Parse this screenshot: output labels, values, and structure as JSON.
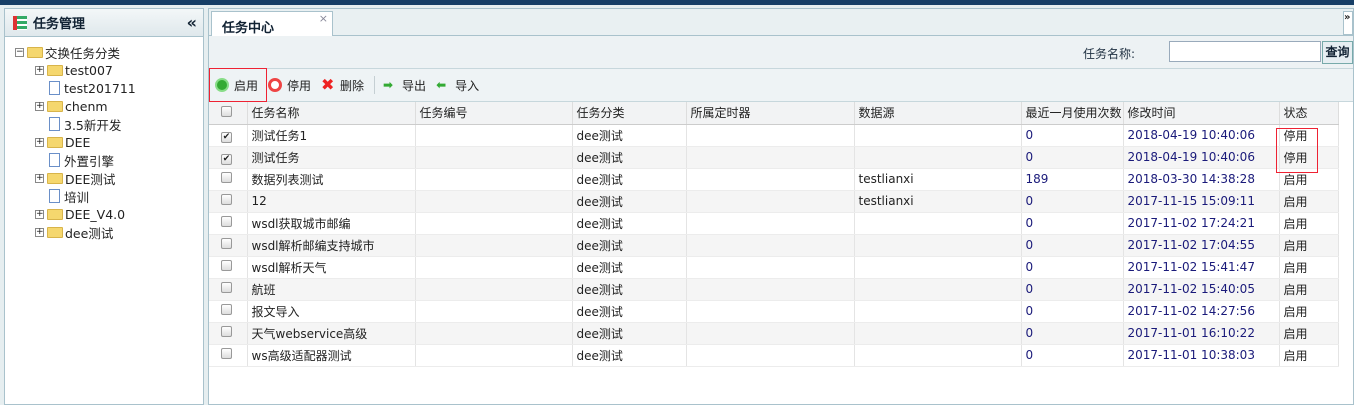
{
  "left": {
    "title": "任务管理",
    "collapse": "«",
    "tree": [
      {
        "label": "交换任务分类",
        "type": "folder",
        "level": 0,
        "expander": "−"
      },
      {
        "label": "test007",
        "type": "folder",
        "level": 1,
        "expander": "+"
      },
      {
        "label": "test201711",
        "type": "file",
        "level": 1
      },
      {
        "label": "chenm",
        "type": "folder",
        "level": 1,
        "expander": "+"
      },
      {
        "label": "3.5新开发",
        "type": "file",
        "level": 1
      },
      {
        "label": "DEE",
        "type": "folder",
        "level": 1,
        "expander": "+"
      },
      {
        "label": "外置引擎",
        "type": "file",
        "level": 1
      },
      {
        "label": "DEE测试",
        "type": "folder",
        "level": 1,
        "expander": "+"
      },
      {
        "label": "培训",
        "type": "file",
        "level": 1
      },
      {
        "label": "DEE_V4.0",
        "type": "folder",
        "level": 1,
        "expander": "+"
      },
      {
        "label": "dee测试",
        "type": "folder",
        "level": 1,
        "expander": "+"
      }
    ]
  },
  "tab": {
    "label": "任务中心",
    "close": "×",
    "scroll": "»"
  },
  "search": {
    "label": "任务名称:",
    "value": "",
    "button": "查询"
  },
  "toolbar": {
    "enable": "启用",
    "disable": "停用",
    "delete": "删除",
    "export": "导出",
    "import": "导入"
  },
  "table": {
    "headers": [
      "任务名称",
      "任务编号",
      "任务分类",
      "所属定时器",
      "数据源",
      "最近一月使用次数",
      "修改时间",
      "状态"
    ],
    "rows": [
      {
        "checked": true,
        "name": "测试任务1",
        "code": "",
        "cat": "dee测试",
        "timer": "",
        "ds": "",
        "count": "0",
        "time": "2018-04-19 10:40:06",
        "status": "停用"
      },
      {
        "checked": true,
        "name": "测试任务",
        "code": "",
        "cat": "dee测试",
        "timer": "",
        "ds": "",
        "count": "0",
        "time": "2018-04-19 10:40:06",
        "status": "停用"
      },
      {
        "checked": false,
        "name": "数据列表测试",
        "code": "",
        "cat": "dee测试",
        "timer": "",
        "ds": "testlianxi",
        "count": "189",
        "time": "2018-03-30 14:38:28",
        "status": "启用"
      },
      {
        "checked": false,
        "name": "12",
        "code": "",
        "cat": "dee测试",
        "timer": "",
        "ds": "testlianxi",
        "count": "0",
        "time": "2017-11-15 15:09:11",
        "status": "启用"
      },
      {
        "checked": false,
        "name": "wsdl获取城市邮编",
        "code": "",
        "cat": "dee测试",
        "timer": "",
        "ds": "",
        "count": "0",
        "time": "2017-11-02 17:24:21",
        "status": "启用"
      },
      {
        "checked": false,
        "name": "wsdl解析邮编支持城市",
        "code": "",
        "cat": "dee测试",
        "timer": "",
        "ds": "",
        "count": "0",
        "time": "2017-11-02 17:04:55",
        "status": "启用"
      },
      {
        "checked": false,
        "name": "wsdl解析天气",
        "code": "",
        "cat": "dee测试",
        "timer": "",
        "ds": "",
        "count": "0",
        "time": "2017-11-02 15:41:47",
        "status": "启用"
      },
      {
        "checked": false,
        "name": "航班",
        "code": "",
        "cat": "dee测试",
        "timer": "",
        "ds": "",
        "count": "0",
        "time": "2017-11-02 15:40:05",
        "status": "启用"
      },
      {
        "checked": false,
        "name": "报文导入",
        "code": "",
        "cat": "dee测试",
        "timer": "",
        "ds": "",
        "count": "0",
        "time": "2017-11-02 14:27:56",
        "status": "启用"
      },
      {
        "checked": false,
        "name": "天气webservice高级",
        "code": "",
        "cat": "dee测试",
        "timer": "",
        "ds": "",
        "count": "0",
        "time": "2017-11-01 16:10:22",
        "status": "启用"
      },
      {
        "checked": false,
        "name": "ws高级适配器测试",
        "code": "",
        "cat": "dee测试",
        "timer": "",
        "ds": "",
        "count": "0",
        "time": "2017-11-01 10:38:03",
        "status": "启用"
      }
    ]
  }
}
